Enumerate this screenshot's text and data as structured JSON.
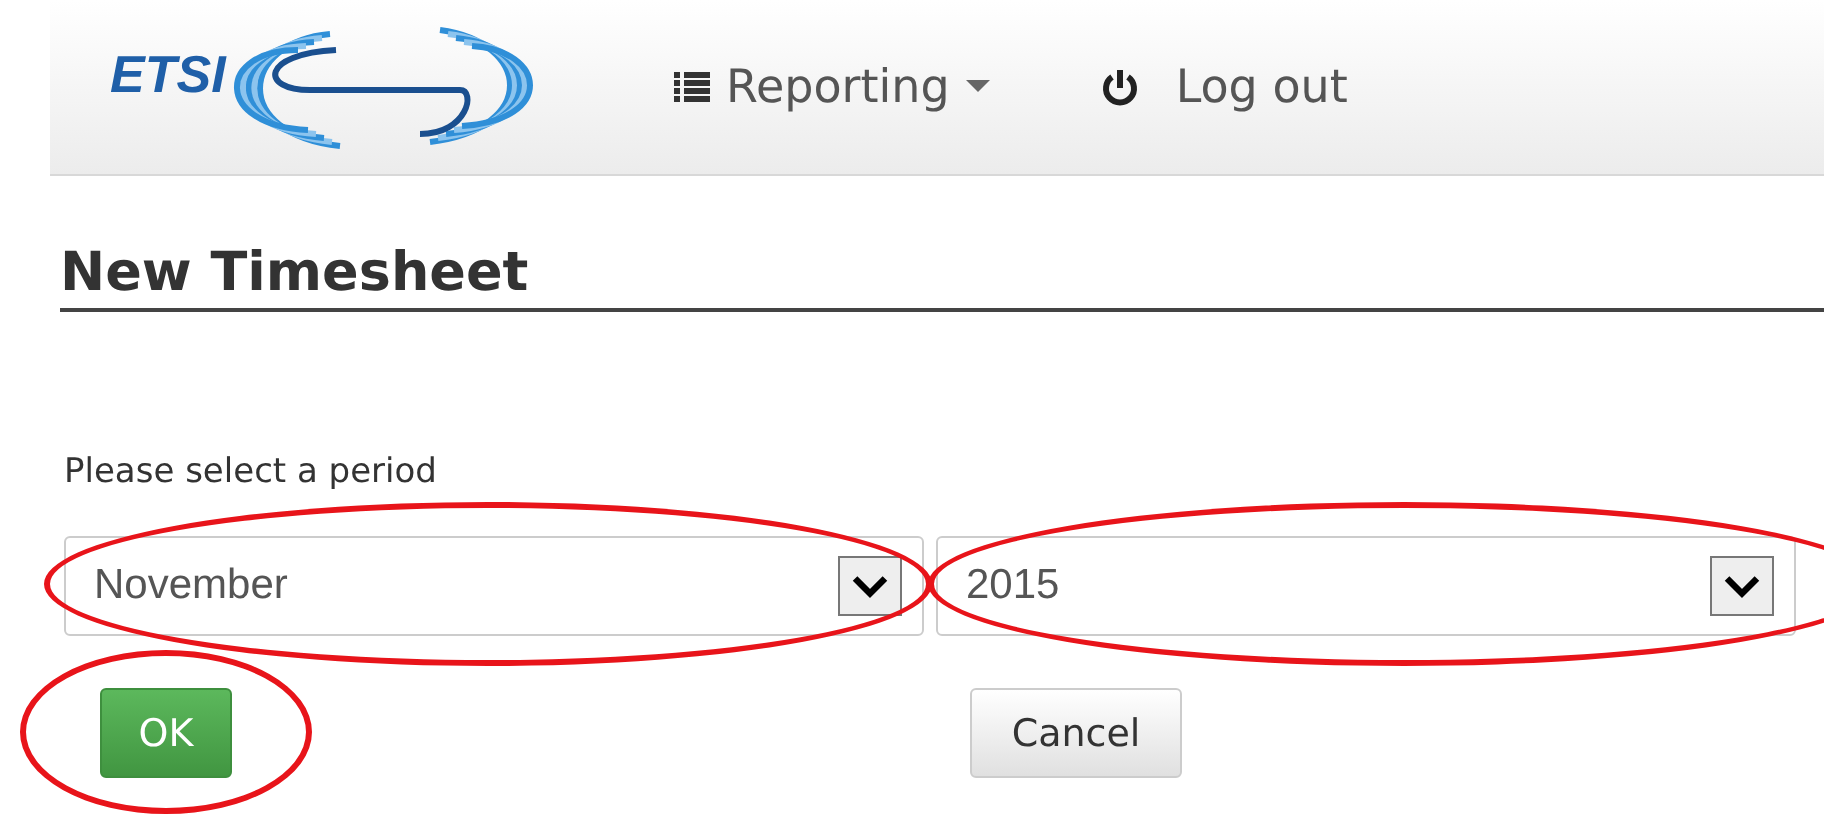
{
  "navbar": {
    "logo_text": "ETSI",
    "items": [
      {
        "label": "Reporting",
        "kind": "dropdown"
      },
      {
        "label": "Log out",
        "kind": "power"
      }
    ]
  },
  "page_title": "New Timesheet",
  "prompt": "Please select a period",
  "selects": [
    {
      "value": "November",
      "annotated": true
    },
    {
      "value": "2015",
      "annotated": true
    }
  ],
  "buttons": [
    {
      "label": "OK",
      "kind": "primary",
      "annotated": true
    },
    {
      "label": "Cancel",
      "kind": "default"
    }
  ]
}
